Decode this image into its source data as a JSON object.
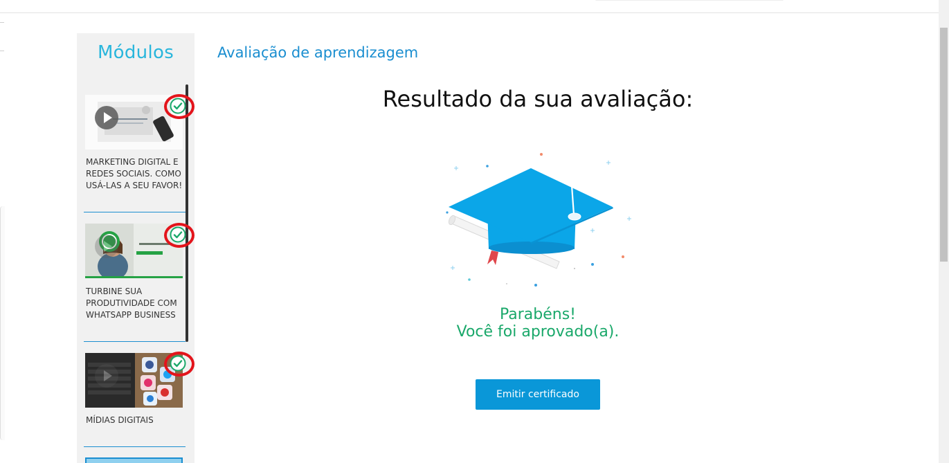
{
  "sidebar": {
    "title": "Módulos",
    "modules": [
      {
        "title": "MARKETING DIGITAL E REDES SOCIAIS. COMO USÁ-LAS A SEU FAVOR!",
        "thumb_caption": "MARKETING DIGITAL",
        "completed": true
      },
      {
        "title": "TURBINE SUA PRODUTIVIDADE COM WHATSAPP BUSINESS",
        "thumb_caption": "WhatsApp",
        "completed": true
      },
      {
        "title": "MÍDIAS DIGITAIS",
        "thumb_caption": "",
        "completed": true
      }
    ]
  },
  "main": {
    "heading": "Avaliação de aprendizagem",
    "result_title": "Resultado da sua avaliação:",
    "congrats_line1": "Parabéns!",
    "congrats_line2": "Você foi aprovado(a).",
    "certificate_button": "Emitir certificado"
  },
  "colors": {
    "accent": "#1a8ed0",
    "sidebar_title": "#29b6dc",
    "success": "#1aa86a",
    "button": "#0a97d8",
    "highlight_ring": "#e3141b"
  },
  "icons": [
    "check-circle-icon",
    "play-icon",
    "graduation-cap-icon"
  ]
}
